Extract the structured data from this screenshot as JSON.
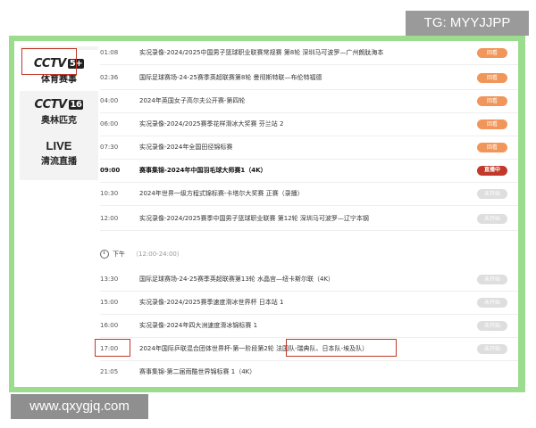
{
  "watermark_top": "TG: MYYJJPP",
  "watermark_bottom": "www.qxygjq.com",
  "sidebar": {
    "channels": [
      {
        "logo": "CCTV",
        "num": "5+",
        "sub": "体育赛事"
      },
      {
        "logo": "CCTV",
        "num": "16",
        "sub": "奥林匹克"
      },
      {
        "logo": "LIVE",
        "num": "",
        "sub": "清流直播"
      }
    ]
  },
  "section_afternoon": {
    "label": "下午",
    "range": "（12:00-24:00）"
  },
  "badges": {
    "replay": "回看",
    "live": "直播中",
    "upcoming": "未开始"
  },
  "schedule": [
    {
      "time": "01:08",
      "title": "实况录像-2024/2025中国男子篮球职业联赛常规赛 第8轮  深圳马可波罗—广州朗肽海本",
      "status": "回看"
    },
    {
      "time": "02:36",
      "title": "国际足球赛场-24-25赛季英超联赛第8轮 曼彻斯特联—布伦特福德",
      "status": "回看"
    },
    {
      "time": "04:00",
      "title": "2024年英国女子高尔夫公开赛-第四轮",
      "status": "回看"
    },
    {
      "time": "06:00",
      "title": "实况录像-2024/2025赛季花样滑冰大奖赛 芬兰站 2",
      "status": "回看"
    },
    {
      "time": "07:30",
      "title": "实况录像-2024年全国田径锦标赛",
      "status": "回看"
    },
    {
      "time": "09:00",
      "title": "赛事集锦-2024年中国羽毛球大师赛1（4K）",
      "status": "直播中"
    },
    {
      "time": "10:30",
      "title": "2024年世界一级方程式锦标赛-卡塔尔大奖赛 正赛（录播）",
      "status": "未开始"
    },
    {
      "time": "12:00",
      "title": "实况录像-2024/2025赛季中国男子篮球职业联赛 第12轮  深圳马可波罗—辽宁本钢",
      "status": "未开始"
    },
    {
      "time": "13:30",
      "title": "国际足球赛场-24-25赛季英超联赛第13轮 水晶宫—纽卡斯尔联（4K）",
      "status": "未开始"
    },
    {
      "time": "15:00",
      "title": "实况录像-2024/2025赛季速度滑冰世界杯 日本站 1",
      "status": "未开始"
    },
    {
      "time": "16:00",
      "title": "实况录像-2024年四大洲速度滑冰锦标赛 1",
      "status": "未开始"
    },
    {
      "time": "17:00",
      "title": "2024年国际乒联混合团体世界杯-第一阶段第2轮 法国队-瑞典队、日本队-埃及队）",
      "status": "未开始"
    },
    {
      "time": "21:05",
      "title": "赛事集锦-第二届雨酷世界锦标赛 1（4K）",
      "status": ""
    }
  ]
}
